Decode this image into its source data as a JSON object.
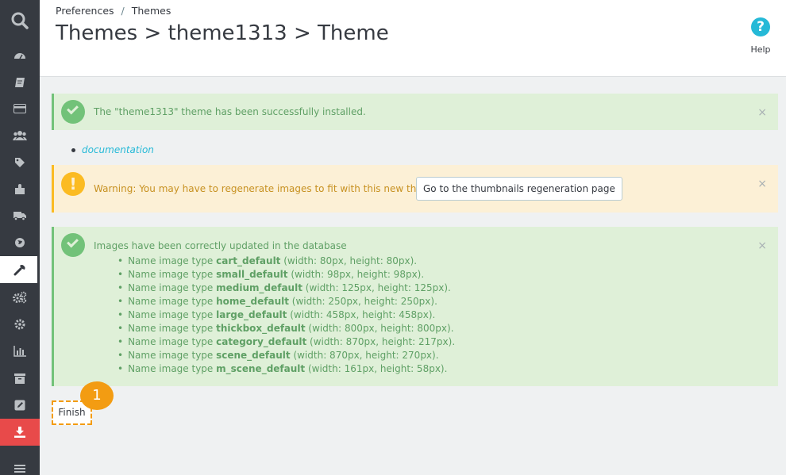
{
  "breadcrumb": [
    "Preferences",
    "Themes"
  ],
  "breadcrumb_separator": "/",
  "page_title": "Themes > theme1313 > Theme",
  "help_label": "Help",
  "sidebar": {
    "bg_color": "#363a41",
    "icons": [
      "search-icon",
      "dashboard-icon",
      "orders-icon",
      "catalog-icon",
      "customers-icon",
      "price-rules-icon",
      "modules-icon",
      "shipping-icon",
      "localization-icon",
      "preferences-icon",
      "advanced-parameters-icon",
      "administration-icon",
      "stats-icon",
      "stock-icon",
      "edit-icon",
      "download-icon",
      "menu-icon"
    ],
    "active_item": "preferences-icon"
  },
  "alerts": {
    "installed": "The \"theme1313\" theme has been successfully installed.",
    "documentation_link": "documentation",
    "warning_text": "Warning: You may have to regenerate images to fit with this new theme.",
    "regen_button": "Go to the thumbnails regeneration page",
    "images_updated": "Images have been correctly updated in the database",
    "close_symbol": "×"
  },
  "image_types": [
    {
      "prefix": "Name image type ",
      "name": "cart_default",
      "dims": " (width: 80px, height: 80px)."
    },
    {
      "prefix": "Name image type ",
      "name": "small_default",
      "dims": " (width: 98px, height: 98px)."
    },
    {
      "prefix": "Name image type ",
      "name": "medium_default",
      "dims": " (width: 125px, height: 125px)."
    },
    {
      "prefix": "Name image type ",
      "name": "home_default",
      "dims": " (width: 250px, height: 250px)."
    },
    {
      "prefix": "Name image type ",
      "name": "large_default",
      "dims": " (width: 458px, height: 458px)."
    },
    {
      "prefix": "Name image type ",
      "name": "thickbox_default",
      "dims": " (width: 800px, height: 800px)."
    },
    {
      "prefix": "Name image type ",
      "name": "category_default",
      "dims": " (width: 870px, height: 217px)."
    },
    {
      "prefix": "Name image type ",
      "name": "scene_default",
      "dims": " (width: 870px, height: 270px)."
    },
    {
      "prefix": "Name image type ",
      "name": "m_scene_default",
      "dims": " (width: 161px, height: 58px)."
    }
  ],
  "finish_button": "Finish",
  "step_badge": "1",
  "colors": {
    "success_bg": "#dff0d8",
    "success_accent": "#72c279",
    "warning_bg": "#fcf0d6",
    "warning_accent": "#fbbb22",
    "link": "#25b9d7",
    "badge": "#f39c12",
    "sidebar_red": "#e84a4a"
  }
}
